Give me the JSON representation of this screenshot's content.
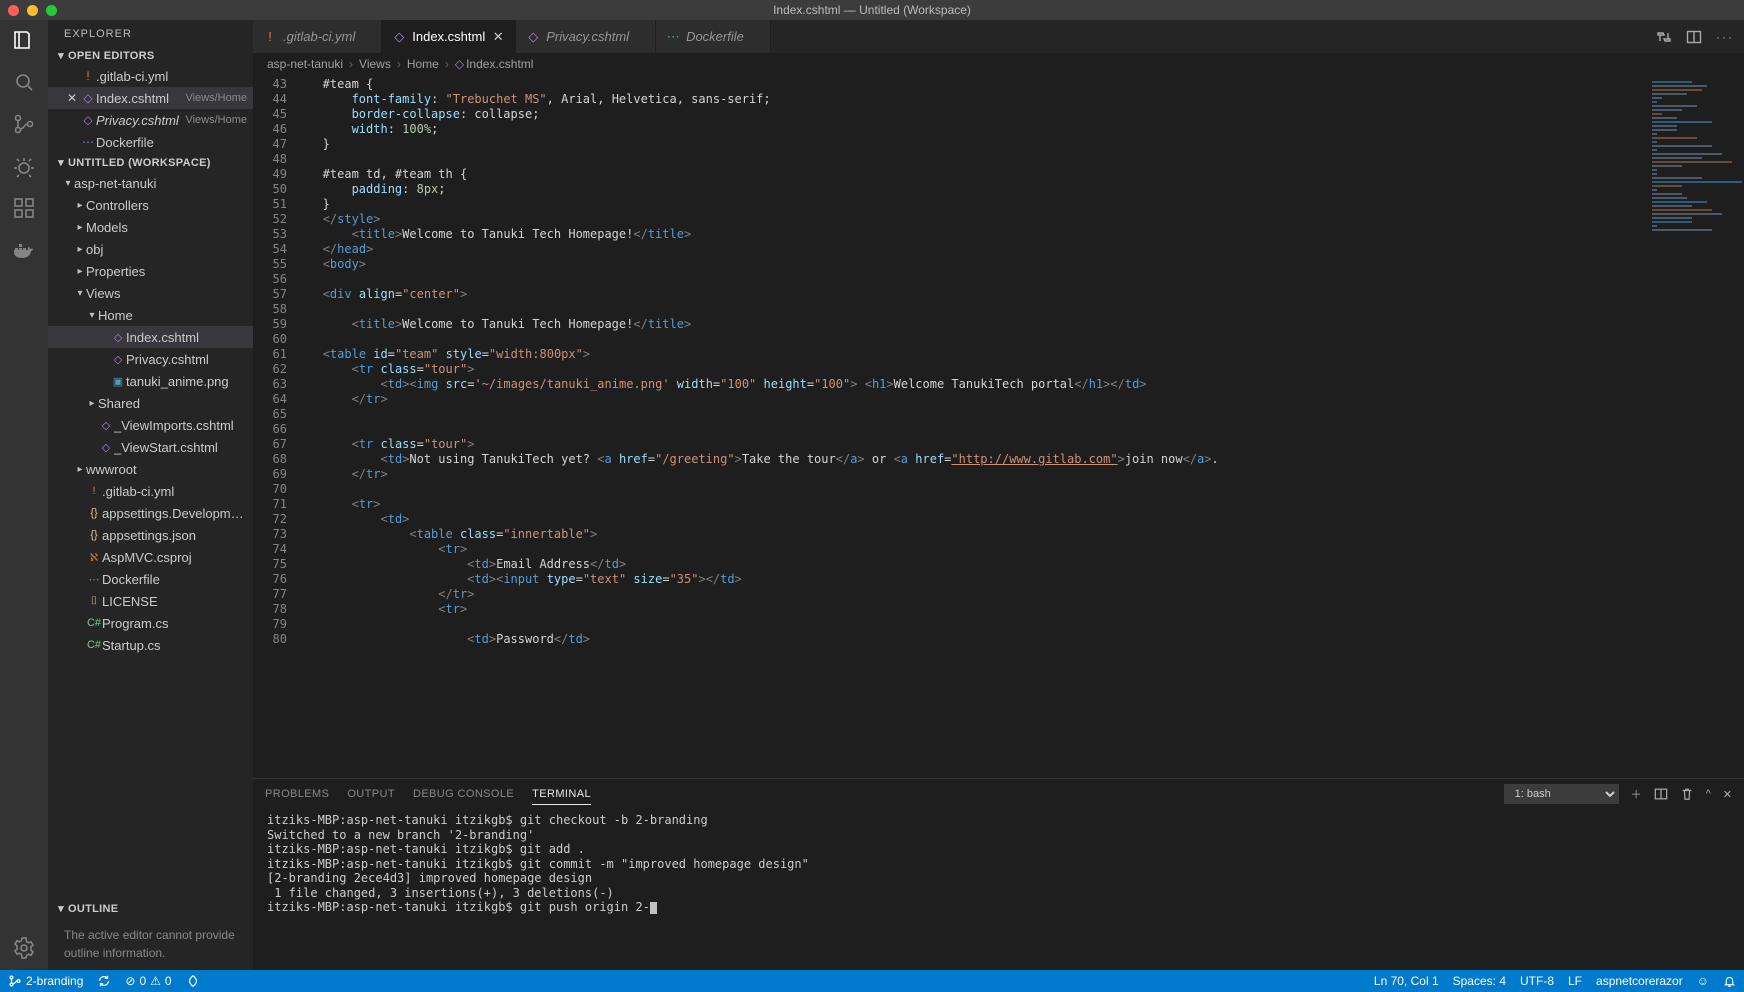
{
  "window_title": "Index.cshtml — Untitled (Workspace)",
  "sidebar": {
    "title": "EXPLORER",
    "open_editors_label": "OPEN EDITORS",
    "workspace_label": "UNTITLED (WORKSPACE)",
    "outline_label": "OUTLINE",
    "outline_msg": "The active editor cannot provide outline information.",
    "open_editors": [
      {
        "name": ".gitlab-ci.yml",
        "icon": "!",
        "iconClass": "clr-orange",
        "italic": false,
        "modified": false
      },
      {
        "name": "Index.cshtml",
        "icon": "◇",
        "iconClass": "clr-purple",
        "italic": false,
        "close": true,
        "meta": "Views/Home",
        "selected": true
      },
      {
        "name": "Privacy.cshtml",
        "icon": "◇",
        "iconClass": "clr-purple",
        "italic": true,
        "meta": "Views/Home"
      },
      {
        "name": "Dockerfile",
        "icon": "⋯",
        "iconClass": "clr-blue",
        "italic": false
      }
    ],
    "tree": [
      {
        "depth": 0,
        "chev": "▾",
        "name": "asp-net-tanuki"
      },
      {
        "depth": 1,
        "chev": "▸",
        "name": "Controllers"
      },
      {
        "depth": 1,
        "chev": "▸",
        "name": "Models"
      },
      {
        "depth": 1,
        "chev": "▸",
        "name": "obj"
      },
      {
        "depth": 1,
        "chev": "▸",
        "name": "Properties"
      },
      {
        "depth": 1,
        "chev": "▾",
        "name": "Views"
      },
      {
        "depth": 2,
        "chev": "▾",
        "name": "Home"
      },
      {
        "depth": 3,
        "icon": "◇",
        "iconClass": "clr-purple",
        "name": "Index.cshtml",
        "selected": true
      },
      {
        "depth": 3,
        "icon": "◇",
        "iconClass": "clr-purple",
        "name": "Privacy.cshtml"
      },
      {
        "depth": 3,
        "icon": "▣",
        "iconClass": "clr-blue",
        "name": "tanuki_anime.png"
      },
      {
        "depth": 2,
        "chev": "▸",
        "name": "Shared"
      },
      {
        "depth": 2,
        "icon": "◇",
        "iconClass": "clr-purple",
        "name": "_ViewImports.cshtml"
      },
      {
        "depth": 2,
        "icon": "◇",
        "iconClass": "clr-purple",
        "name": "_ViewStart.cshtml"
      },
      {
        "depth": 1,
        "chev": "▸",
        "name": "wwwroot"
      },
      {
        "depth": 1,
        "icon": "!",
        "iconClass": "clr-orange",
        "name": ".gitlab-ci.yml"
      },
      {
        "depth": 1,
        "icon": "{}",
        "iconClass": "clr-yellow",
        "name": "appsettings.Development.json"
      },
      {
        "depth": 1,
        "icon": "{}",
        "iconClass": "clr-yellow",
        "name": "appsettings.json"
      },
      {
        "depth": 1,
        "icon": "ℵ",
        "iconClass": "clr-orange",
        "name": "AspMVC.csproj"
      },
      {
        "depth": 1,
        "icon": "⋯",
        "iconClass": "clr-blue",
        "name": "Dockerfile"
      },
      {
        "depth": 1,
        "icon": "⌷",
        "iconClass": "clr-yellow",
        "name": "LICENSE"
      },
      {
        "depth": 1,
        "icon": "C#",
        "iconClass": "clr-cyan",
        "name": "Program.cs"
      },
      {
        "depth": 1,
        "icon": "C#",
        "iconClass": "clr-cyan",
        "name": "Startup.cs"
      }
    ]
  },
  "tabs": [
    {
      "label": ".gitlab-ci.yml",
      "icon": "!",
      "iconClass": "clr-orange",
      "active": false,
      "italic": false
    },
    {
      "label": "Index.cshtml",
      "icon": "◇",
      "iconClass": "clr-purple",
      "active": true,
      "italic": false,
      "close": true
    },
    {
      "label": "Privacy.cshtml",
      "icon": "◇",
      "iconClass": "clr-purple",
      "active": false,
      "italic": true
    },
    {
      "label": "Dockerfile",
      "icon": "⋯",
      "iconClass": "clr-blue",
      "active": false,
      "italic": false
    }
  ],
  "breadcrumb": [
    "asp-net-tanuki",
    "Views",
    "Home",
    "Index.cshtml"
  ],
  "editor_lines": [
    {
      "n": "43",
      "html": "   #team {"
    },
    {
      "n": "44",
      "html": "       <span class='c-attr'>font-family</span>: <span class='c-str'>\"Trebuchet MS\"</span>, Arial, Helvetica, sans-serif;"
    },
    {
      "n": "45",
      "html": "       <span class='c-attr'>border-collapse</span>: collapse;"
    },
    {
      "n": "46",
      "html": "       <span class='c-attr'>width</span>: <span class='c-num'>100%</span>;"
    },
    {
      "n": "47",
      "html": "   }"
    },
    {
      "n": "48",
      "html": ""
    },
    {
      "n": "49",
      "html": "   #team td, #team th {"
    },
    {
      "n": "50",
      "html": "       <span class='c-attr'>padding</span>: <span class='c-num'>8px</span>;"
    },
    {
      "n": "51",
      "html": "   }"
    },
    {
      "n": "52",
      "html": "   <span class='c-delim'>&lt;/</span><span class='c-tag'>style</span><span class='c-delim'>&gt;</span>"
    },
    {
      "n": "53",
      "html": "       <span class='c-delim'>&lt;</span><span class='c-tag'>title</span><span class='c-delim'>&gt;</span>Welcome to Tanuki Tech Homepage!<span class='c-delim'>&lt;/</span><span class='c-tag'>title</span><span class='c-delim'>&gt;</span>"
    },
    {
      "n": "54",
      "html": "   <span class='c-delim'>&lt;/</span><span class='c-tag'>head</span><span class='c-delim'>&gt;</span>"
    },
    {
      "n": "55",
      "html": "   <span class='c-delim'>&lt;</span><span class='c-tag'>body</span><span class='c-delim'>&gt;</span>"
    },
    {
      "n": "56",
      "html": ""
    },
    {
      "n": "57",
      "html": "   <span class='c-delim'>&lt;</span><span class='c-tag'>div</span> <span class='c-attr'>align</span>=<span class='c-str'>\"center\"</span><span class='c-delim'>&gt;</span>"
    },
    {
      "n": "58",
      "html": ""
    },
    {
      "n": "59",
      "html": "       <span class='c-delim'>&lt;</span><span class='c-tag'>title</span><span class='c-delim'>&gt;</span>Welcome to Tanuki Tech Homepage!<span class='c-delim'>&lt;/</span><span class='c-tag'>title</span><span class='c-delim'>&gt;</span>"
    },
    {
      "n": "60",
      "html": ""
    },
    {
      "n": "61",
      "html": "   <span class='c-delim'>&lt;</span><span class='c-tag'>table</span> <span class='c-attr'>id</span>=<span class='c-str'>\"team\"</span> <span class='c-attr'>style</span>=<span class='c-str'>\"width:800px\"</span><span class='c-delim'>&gt;</span>"
    },
    {
      "n": "62",
      "html": "       <span class='c-delim'>&lt;</span><span class='c-tag'>tr</span> <span class='c-attr'>class</span>=<span class='c-str'>\"tour\"</span><span class='c-delim'>&gt;</span>"
    },
    {
      "n": "63",
      "html": "           <span class='c-delim'>&lt;</span><span class='c-tag'>td</span><span class='c-delim'>&gt;</span><span class='c-delim'>&lt;</span><span class='c-tag'>img</span> <span class='c-attr'>src</span>=<span class='c-str'>'~/images/tanuki_anime.png'</span> <span class='c-attr'>width</span>=<span class='c-str'>\"100\"</span> <span class='c-attr'>height</span>=<span class='c-str'>\"100\"</span><span class='c-delim'>&gt;</span> <span class='c-delim'>&lt;</span><span class='c-tag'>h1</span><span class='c-delim'>&gt;</span>Welcome TanukiTech portal<span class='c-delim'>&lt;/</span><span class='c-tag'>h1</span><span class='c-delim'>&gt;</span><span class='c-delim'>&lt;/</span><span class='c-tag'>td</span><span class='c-delim'>&gt;</span>"
    },
    {
      "n": "64",
      "html": "       <span class='c-delim'>&lt;/</span><span class='c-tag'>tr</span><span class='c-delim'>&gt;</span>"
    },
    {
      "n": "65",
      "html": ""
    },
    {
      "n": "66",
      "html": ""
    },
    {
      "n": "67",
      "html": "       <span class='c-delim'>&lt;</span><span class='c-tag'>tr</span> <span class='c-attr'>class</span>=<span class='c-str'>\"tour\"</span><span class='c-delim'>&gt;</span>"
    },
    {
      "n": "68",
      "html": "           <span class='c-delim'>&lt;</span><span class='c-tag'>td</span><span class='c-delim'>&gt;</span>Not using TanukiTech yet? <span class='c-delim'>&lt;</span><span class='c-tag'>a</span> <span class='c-attr'>href</span>=<span class='c-str'>\"/greeting\"</span><span class='c-delim'>&gt;</span>Take the tour<span class='c-delim'>&lt;/</span><span class='c-tag'>a</span><span class='c-delim'>&gt;</span> or <span class='c-delim'>&lt;</span><span class='c-tag'>a</span> <span class='c-attr'>href</span>=<span class='c-link'>\"http://www.gitlab.com\"</span><span class='c-delim'>&gt;</span>join now<span class='c-delim'>&lt;/</span><span class='c-tag'>a</span><span class='c-delim'>&gt;</span>."
    },
    {
      "n": "69",
      "html": "       <span class='c-delim'>&lt;/</span><span class='c-tag'>tr</span><span class='c-delim'>&gt;</span>"
    },
    {
      "n": "70",
      "html": ""
    },
    {
      "n": "71",
      "html": "       <span class='c-delim'>&lt;</span><span class='c-tag'>tr</span><span class='c-delim'>&gt;</span>"
    },
    {
      "n": "72",
      "html": "           <span class='c-delim'>&lt;</span><span class='c-tag'>td</span><span class='c-delim'>&gt;</span>"
    },
    {
      "n": "73",
      "html": "               <span class='c-delim'>&lt;</span><span class='c-tag'>table</span> <span class='c-attr'>class</span>=<span class='c-str'>\"innertable\"</span><span class='c-delim'>&gt;</span>"
    },
    {
      "n": "74",
      "html": "                   <span class='c-delim'>&lt;</span><span class='c-tag'>tr</span><span class='c-delim'>&gt;</span>"
    },
    {
      "n": "75",
      "html": "                       <span class='c-delim'>&lt;</span><span class='c-tag'>td</span><span class='c-delim'>&gt;</span>Email Address<span class='c-delim'>&lt;/</span><span class='c-tag'>td</span><span class='c-delim'>&gt;</span>"
    },
    {
      "n": "76",
      "html": "                       <span class='c-delim'>&lt;</span><span class='c-tag'>td</span><span class='c-delim'>&gt;</span><span class='c-delim'>&lt;</span><span class='c-tag'>input</span> <span class='c-attr'>type</span>=<span class='c-str'>\"text\"</span> <span class='c-attr'>size</span>=<span class='c-str'>\"35\"</span><span class='c-delim'>&gt;</span><span class='c-delim'>&lt;/</span><span class='c-tag'>td</span><span class='c-delim'>&gt;</span>"
    },
    {
      "n": "77",
      "html": "                   <span class='c-delim'>&lt;/</span><span class='c-tag'>tr</span><span class='c-delim'>&gt;</span>"
    },
    {
      "n": "78",
      "html": "                   <span class='c-delim'>&lt;</span><span class='c-tag'>tr</span><span class='c-delim'>&gt;</span>"
    },
    {
      "n": "79",
      "html": ""
    },
    {
      "n": "80",
      "html": "                       <span class='c-delim'>&lt;</span><span class='c-tag'>td</span><span class='c-delim'>&gt;</span>Password<span class='c-delim'>&lt;/</span><span class='c-tag'>td</span><span class='c-delim'>&gt;</span>"
    }
  ],
  "panel": {
    "tabs": [
      "PROBLEMS",
      "OUTPUT",
      "DEBUG CONSOLE",
      "TERMINAL"
    ],
    "active_tab": "TERMINAL",
    "shell_label": "1: bash",
    "lines": [
      "itziks-MBP:asp-net-tanuki itzikgb$ git checkout -b 2-branding",
      "Switched to a new branch '2-branding'",
      "itziks-MBP:asp-net-tanuki itzikgb$ git add .",
      "itziks-MBP:asp-net-tanuki itzikgb$ git commit -m \"improved homepage design\"",
      "[2-branding 2ece4d3] improved homepage design",
      " 1 file changed, 3 insertions(+), 3 deletions(-)",
      "itziks-MBP:asp-net-tanuki itzikgb$ git push origin 2-"
    ]
  },
  "status": {
    "branch": "2-branding",
    "errors": "0",
    "warnings": "0",
    "ln_col": "Ln 70, Col 1",
    "spaces": "Spaces: 4",
    "encoding": "UTF-8",
    "eol": "LF",
    "lang": "aspnetcorerazor"
  }
}
